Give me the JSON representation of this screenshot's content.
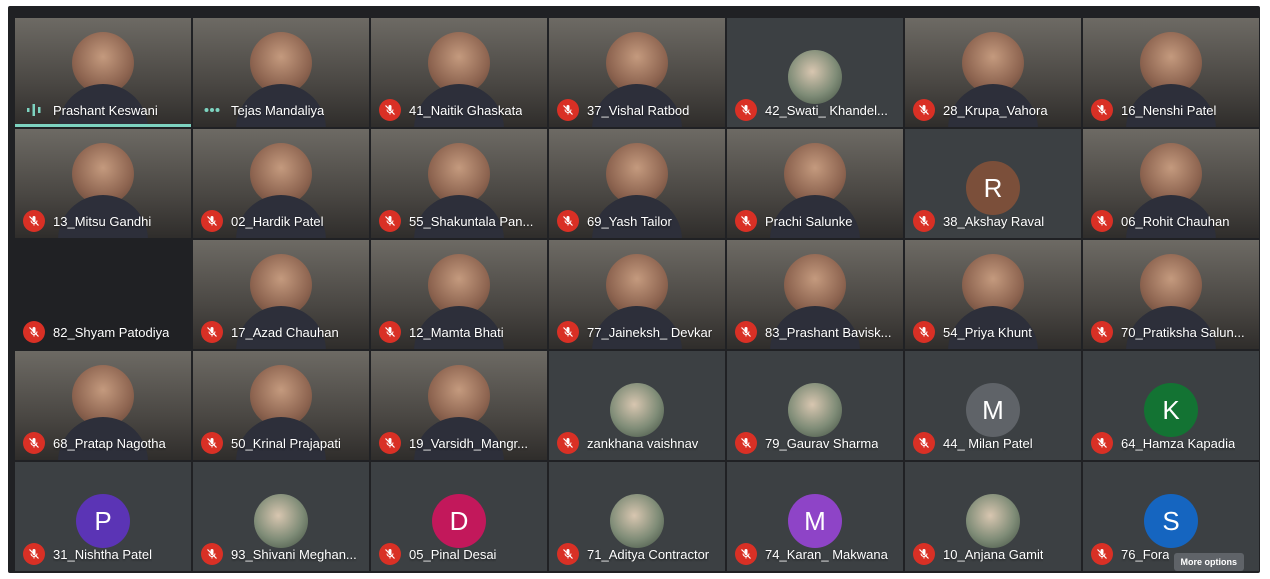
{
  "meeting": {
    "more_options_label": "More options"
  },
  "participants": [
    {
      "name": "Prashant Keswani",
      "tile": "video",
      "mic": "speaking",
      "highlight": true
    },
    {
      "name": "Tejas Mandaliya",
      "tile": "video",
      "mic": "dots"
    },
    {
      "name": "41_Naitik Ghaskata",
      "tile": "video",
      "mic": "muted"
    },
    {
      "name": "37_Vishal Ratbod",
      "tile": "video",
      "mic": "muted"
    },
    {
      "name": "42_Swati_ Khandel...",
      "tile": "photo",
      "mic": "muted"
    },
    {
      "name": "28_Krupa_Vahora",
      "tile": "video",
      "mic": "muted"
    },
    {
      "name": "16_Nenshi Patel",
      "tile": "video",
      "mic": "muted"
    },
    {
      "name": "13_Mitsu Gandhi",
      "tile": "video",
      "mic": "muted"
    },
    {
      "name": "02_Hardik Patel",
      "tile": "video",
      "mic": "muted"
    },
    {
      "name": "55_Shakuntala Pan...",
      "tile": "video",
      "mic": "muted"
    },
    {
      "name": "69_Yash Tailor",
      "tile": "video",
      "mic": "muted"
    },
    {
      "name": "Prachi Salunke",
      "tile": "video",
      "mic": "muted"
    },
    {
      "name": "38_Akshay Raval",
      "tile": "avatar",
      "initial": "R",
      "color": "#7b4f3a",
      "mic": "muted"
    },
    {
      "name": "06_Rohit Chauhan",
      "tile": "video",
      "mic": "muted"
    },
    {
      "name": "82_Shyam Patodiya",
      "tile": "dark",
      "mic": "muted"
    },
    {
      "name": "17_Azad Chauhan",
      "tile": "video",
      "mic": "muted"
    },
    {
      "name": "12_Mamta Bhati",
      "tile": "video",
      "mic": "muted"
    },
    {
      "name": "77_Jainеksh_ Devkar",
      "tile": "video",
      "mic": "muted"
    },
    {
      "name": "83_Prashant Bavisk...",
      "tile": "video",
      "mic": "muted"
    },
    {
      "name": "54_Priya Khunt",
      "tile": "video",
      "mic": "muted"
    },
    {
      "name": "70_Pratiksha Salun...",
      "tile": "video",
      "mic": "muted"
    },
    {
      "name": "68_Pratap Nagotha",
      "tile": "video",
      "mic": "muted"
    },
    {
      "name": "50_Krinal Prajapati",
      "tile": "video",
      "mic": "muted"
    },
    {
      "name": "19_Varsidh_Mangr...",
      "tile": "video",
      "mic": "muted"
    },
    {
      "name": "zankhana vaishnav",
      "tile": "photo",
      "mic": "muted"
    },
    {
      "name": "79_Gaurav Sharma",
      "tile": "photo",
      "mic": "muted"
    },
    {
      "name": "44_ Milan Patel",
      "tile": "avatar",
      "initial": "M",
      "color": "#5f6368",
      "mic": "muted"
    },
    {
      "name": "64_Hamza Kapadia",
      "tile": "avatar",
      "initial": "K",
      "color": "#137333",
      "mic": "muted"
    },
    {
      "name": "31_Nishtha Patel",
      "tile": "avatar",
      "initial": "P",
      "color": "#5b34b5",
      "mic": "muted"
    },
    {
      "name": "93_Shivani Meghan...",
      "tile": "photo",
      "mic": "muted"
    },
    {
      "name": "05_Pinal Desai",
      "tile": "avatar",
      "initial": "D",
      "color": "#c2185b",
      "mic": "muted"
    },
    {
      "name": "71_Aditya Contractor",
      "tile": "photo",
      "mic": "muted"
    },
    {
      "name": "74_Karan_ Makwana",
      "tile": "avatar",
      "initial": "M",
      "color": "#8e44c7",
      "mic": "muted"
    },
    {
      "name": "10_Anjana Gamit",
      "tile": "photo",
      "mic": "muted"
    },
    {
      "name": "76_Fora",
      "tile": "avatar",
      "initial": "S",
      "color": "#1565c0",
      "mic": "muted"
    }
  ]
}
